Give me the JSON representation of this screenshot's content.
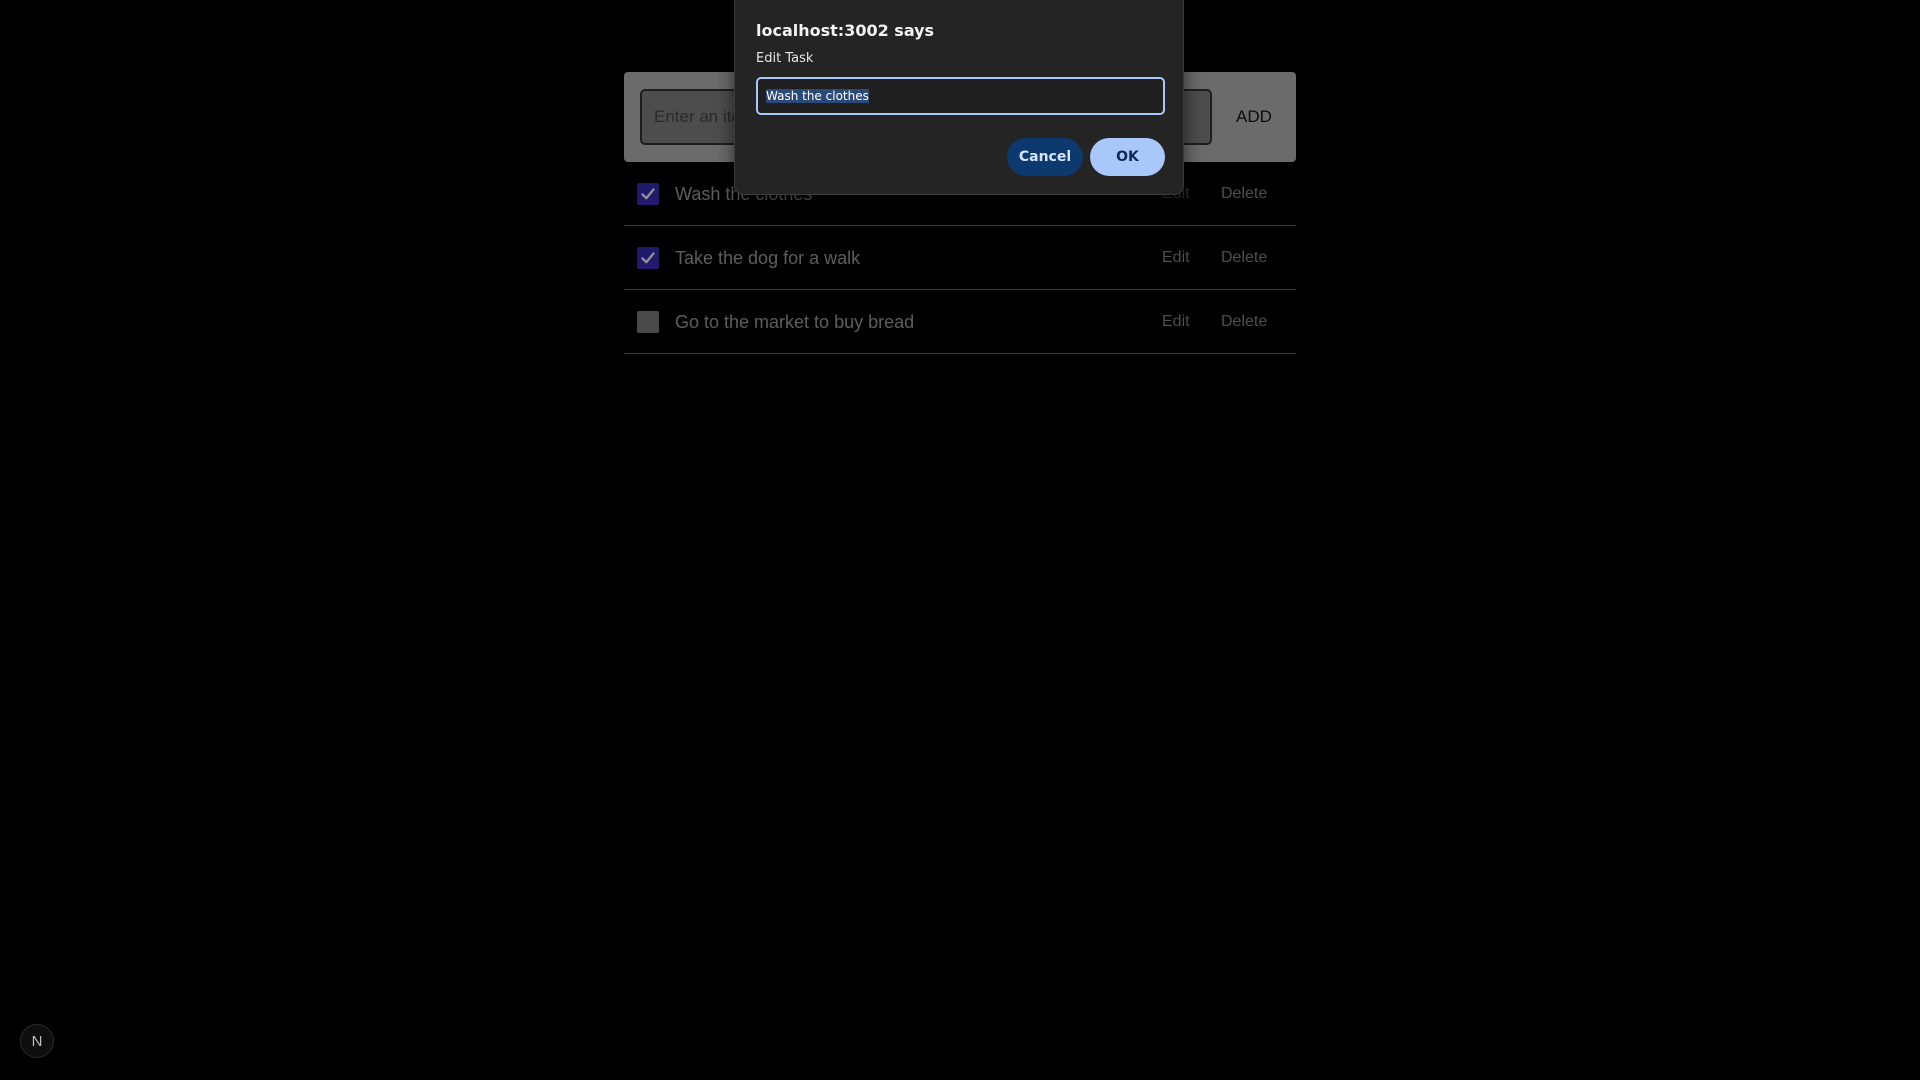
{
  "app": {
    "input_placeholder": "Enter an item",
    "add_label": "ADD",
    "todos": [
      {
        "text": "Wash the clothes",
        "checked": true,
        "edit_label": "Edit",
        "delete_label": "Delete"
      },
      {
        "text": "Take the dog for a walk",
        "checked": true,
        "edit_label": "Edit",
        "delete_label": "Delete"
      },
      {
        "text": "Go to the market to buy bread",
        "checked": false,
        "edit_label": "Edit",
        "delete_label": "Delete"
      }
    ]
  },
  "dialog": {
    "title": "localhost:3002 says",
    "message": "Edit Task",
    "input_value": "Wash the clothes",
    "cancel_label": "Cancel",
    "ok_label": "OK"
  },
  "dev_badge": {
    "label": "N"
  },
  "colors": {
    "background": "#000000",
    "checkbox_checked": "#1f1a6b",
    "dialog_accent": "#a8c7fa",
    "dialog_cancel": "#0c3a6e"
  }
}
